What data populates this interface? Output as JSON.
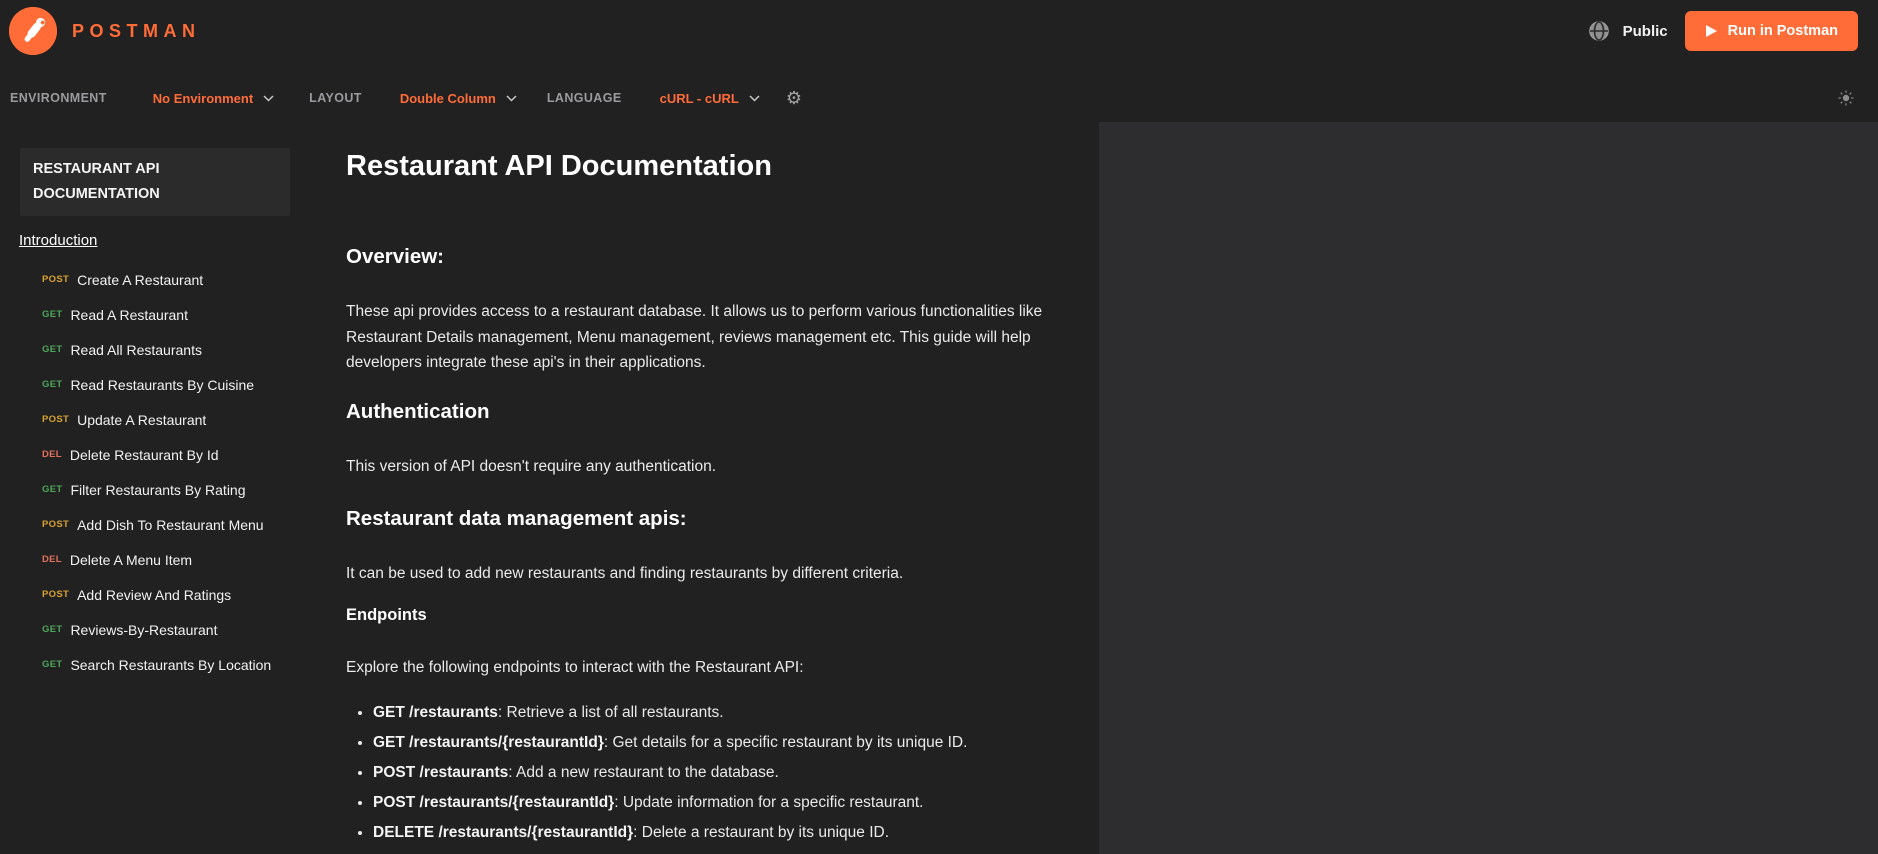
{
  "header": {
    "brand": "POSTMAN",
    "visibility_label": "Public",
    "run_button_label": "Run in Postman"
  },
  "toolbar": {
    "environment_label": "ENVIRONMENT",
    "environment_value": "No Environment",
    "layout_label": "LAYOUT",
    "layout_value": "Double Column",
    "language_label": "LANGUAGE",
    "language_value": "cURL - cURL"
  },
  "icons": {
    "logo": "postman-astronaut",
    "globe": "globe-grid",
    "play": "triangle-right",
    "chevron": "chevron-down",
    "gear": "⚙",
    "sun": "sun-rays"
  },
  "sidebar": {
    "title": "RESTAURANT API DOCUMENTATION",
    "intro_link": "Introduction",
    "items": [
      {
        "method": "POST",
        "label": "Create A Restaurant"
      },
      {
        "method": "GET",
        "label": "Read A Restaurant"
      },
      {
        "method": "GET",
        "label": "Read All Restaurants"
      },
      {
        "method": "GET",
        "label": "Read Restaurants By Cuisine"
      },
      {
        "method": "POST",
        "label": "Update A Restaurant"
      },
      {
        "method": "DEL",
        "label": "Delete Restaurant By Id"
      },
      {
        "method": "GET",
        "label": "Filter Restaurants By Rating"
      },
      {
        "method": "POST",
        "label": "Add Dish To Restaurant Menu"
      },
      {
        "method": "DEL",
        "label": "Delete A Menu Item"
      },
      {
        "method": "POST",
        "label": "Add Review And Ratings"
      },
      {
        "method": "GET",
        "label": "Reviews-By-Restaurant"
      },
      {
        "method": "GET",
        "label": "Search Restaurants By Location"
      }
    ]
  },
  "main": {
    "title": "Restaurant API Documentation",
    "overview": {
      "heading": "Overview:",
      "body": "These api provides access to a restaurant database. It allows us to perform various functionalities like Restaurant Details management, Menu management, reviews management etc. This guide will help developers integrate these api's in their applications."
    },
    "authentication": {
      "heading": "Authentication",
      "body": "This version of API doesn't require any authentication."
    },
    "management": {
      "heading": "Restaurant data management apis:",
      "body": "It can be used to add new restaurants and finding restaurants by different criteria."
    },
    "endpoints": {
      "heading": "Endpoints",
      "intro": "Explore the following endpoints to interact with the Restaurant API:",
      "items": [
        {
          "code": "GET /restaurants",
          "desc": ": Retrieve a list of all restaurants."
        },
        {
          "code": "GET /restaurants/{restaurantId}",
          "desc": ": Get details for a specific restaurant by its unique ID."
        },
        {
          "code": "POST /restaurants",
          "desc": ": Add a new restaurant to the database."
        },
        {
          "code": "POST /restaurants/{restaurantId}",
          "desc": ": Update information for a specific restaurant."
        },
        {
          "code": "DELETE /restaurants/{restaurantId}",
          "desc": ": Delete a restaurant by its unique ID."
        }
      ]
    }
  },
  "colors": {
    "accent_orange": "#ff6c37",
    "page_bg": "#212122",
    "right_panel_bg": "#2d2d2f",
    "sidebar_box_bg": "#2b2b2c",
    "muted_label": "#9b9b9d",
    "method_get": "#4da558",
    "method_post": "#d7a231",
    "method_delete": "#e2705a"
  }
}
